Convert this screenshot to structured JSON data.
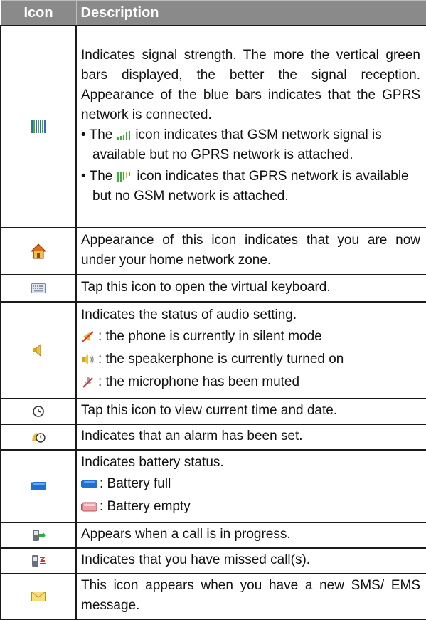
{
  "header": {
    "icon_col": "Icon",
    "desc_col": "Description"
  },
  "rows": [
    {
      "icon": "signal-strength-icon",
      "text": "Indicates signal strength. The more the vertical green bars displayed, the better the signal reception. Appearance of the blue bars indicates that the GPRS network is connected.",
      "bullets": [
        {
          "prefix": "• The",
          "icon": "gsm-signal-icon",
          "suffix": "icon indicates that GSM network signal is available but no GPRS network is attached."
        },
        {
          "prefix": "• The",
          "icon": "gprs-signal-icon",
          "suffix": "icon indicates that GPRS network is available but no GSM network is attached."
        }
      ]
    },
    {
      "icon": "home-icon",
      "text": "Appearance of this icon indicates that you are now under your home network zone."
    },
    {
      "icon": "keyboard-icon",
      "text": "Tap this icon to open the virtual keyboard."
    },
    {
      "icon": "speaker-icon",
      "text": "Indicates the status of audio setting.",
      "legend": [
        {
          "icon": "silent-mode-icon",
          "text": ": the phone is currently in silent mode"
        },
        {
          "icon": "speakerphone-icon",
          "text": ": the speakerphone is currently turned on"
        },
        {
          "icon": "mic-muted-icon",
          "text": ": the microphone has been muted"
        }
      ]
    },
    {
      "icon": "clock-icon",
      "text": "Tap this icon to view current time and date."
    },
    {
      "icon": "alarm-icon",
      "text": "Indicates that an alarm has been set."
    },
    {
      "icon": "battery-icon",
      "text": "Indicates battery status.",
      "legend": [
        {
          "icon": "battery-full-icon",
          "text": ": Battery full"
        },
        {
          "icon": "battery-empty-icon",
          "text": ": Battery empty"
        }
      ]
    },
    {
      "icon": "call-in-progress-icon",
      "text": "Appears when a call is in progress."
    },
    {
      "icon": "missed-call-icon",
      "text": "Indicates that you have missed call(s)."
    },
    {
      "icon": "new-message-icon",
      "text": "This icon appears when you have a new SMS/ EMS message."
    }
  ],
  "colors": {
    "header_bg": "#8a8a8a",
    "signal_green": "#3fae3f",
    "signal_blue": "#3a66c9",
    "battery_blue": "#1f6fd6",
    "battery_pink": "#e9a3a8"
  }
}
